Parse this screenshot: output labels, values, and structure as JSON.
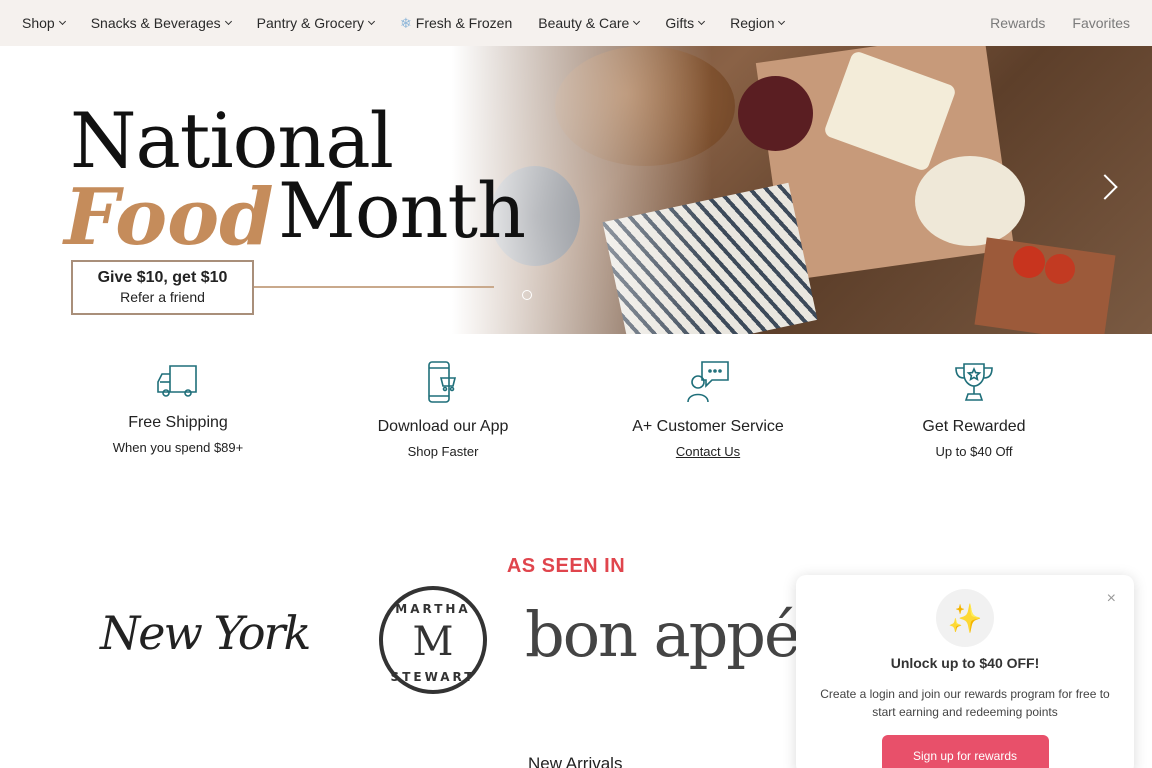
{
  "nav": {
    "items": [
      {
        "label": "Shop",
        "has_chevron": true
      },
      {
        "label": "Snacks & Beverages",
        "has_chevron": true
      },
      {
        "label": "Pantry & Grocery",
        "has_chevron": true
      },
      {
        "label": "Fresh & Frozen",
        "has_chevron": false,
        "icon": "snowflake-icon"
      },
      {
        "label": "Beauty & Care",
        "has_chevron": true
      },
      {
        "label": "Gifts",
        "has_chevron": true
      },
      {
        "label": "Region",
        "has_chevron": true
      }
    ],
    "right": {
      "rewards": "Rewards",
      "favorites": "Favorites"
    }
  },
  "hero": {
    "headline_1": "National",
    "headline_food": "Food",
    "headline_month": "Month",
    "refer_line1": "Give $10, get $10",
    "refer_line2": "Refer a friend"
  },
  "features": [
    {
      "title": "Free Shipping",
      "sub": "When you spend $89+",
      "icon": "truck-icon"
    },
    {
      "title": "Download our App",
      "sub": "Shop Faster",
      "icon": "phone-cart-icon"
    },
    {
      "title": "A+ Customer Service",
      "sub": "Contact Us",
      "icon": "chat-support-icon"
    },
    {
      "title": "Get Rewarded",
      "sub": "Up to $40 Off",
      "icon": "trophy-icon"
    }
  ],
  "as_seen_in": {
    "heading": "AS SEEN IN",
    "logos": {
      "ny": "New York",
      "martha_top": "MARTHA",
      "martha_m": "M",
      "martha_bottom": "STEWART",
      "bon": "bon appéti"
    }
  },
  "new_arrivals": "New Arrivals",
  "popup": {
    "title": "Unlock up to $40 OFF!",
    "text": "Create a login and join our rewards program for free to start earning and redeeming points",
    "button": "Sign up for rewards",
    "close": "×"
  },
  "colors": {
    "accent": "#e0454d",
    "food_gold": "#c58c5b",
    "button": "#e8506a",
    "teal_icon": "#1f6f7a"
  }
}
